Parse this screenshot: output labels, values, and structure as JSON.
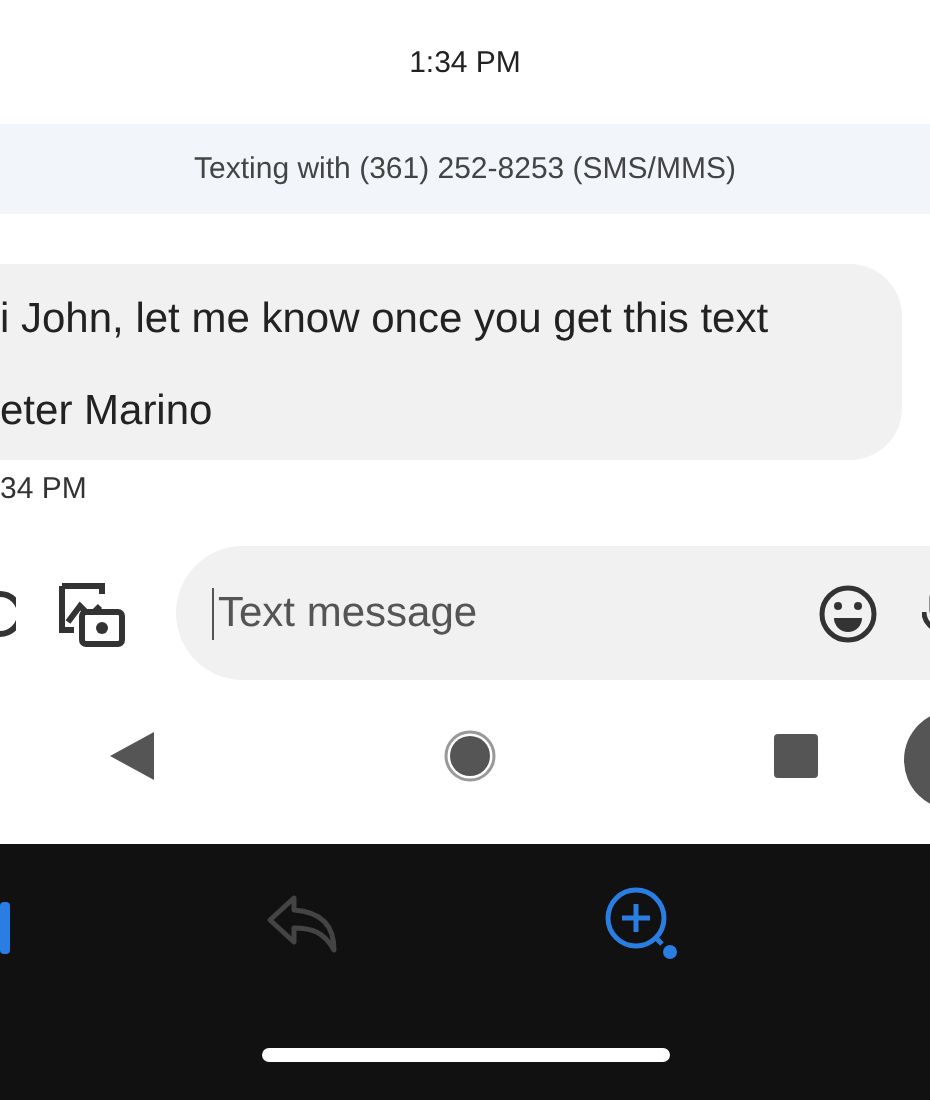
{
  "header": {
    "time": "1:34 PM"
  },
  "banner": {
    "text": "Texting with (361) 252-8253 (SMS/MMS)"
  },
  "messages": [
    {
      "lines": [
        "i John, let me know once you get this text",
        "eter Marino"
      ],
      "timestamp": "34 PM"
    }
  ],
  "composer": {
    "placeholder": "Text message"
  }
}
